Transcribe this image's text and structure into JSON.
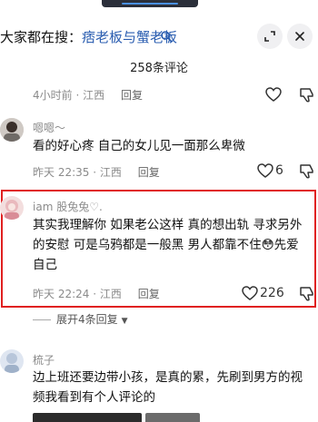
{
  "search": {
    "prefix": "大家都在搜：",
    "keyword": "痞老板与蟹老板",
    "icons": [
      "search-icon",
      "expand-icon",
      "close-icon"
    ]
  },
  "comments_header": {
    "count_label": "258条评论"
  },
  "comments": [
    {
      "time": "4小时前",
      "location": "江西",
      "reply_label": "回复"
    },
    {
      "username": "嗯嗯～",
      "text": "看的好心疼 自己的女儿见一面那么卑微",
      "time": "昨天 22:35",
      "location": "江西",
      "reply_label": "回复",
      "likes": "6"
    },
    {
      "username": "iam 股兔兔♡.",
      "text": "其实我理解你 如果老公这样 真的想出轨 寻求另外的安慰 可是乌鸦都是一般黑 男人都靠不住😳先爱自己",
      "time": "昨天 22:24",
      "location": "江西",
      "reply_label": "回复",
      "likes": "226",
      "highlighted": true
    },
    {
      "username": "梳子",
      "text": "边上班还要边带小孩，是真的累，先刷到男方的视频我看到有个人评论的"
    }
  ],
  "expand_replies": {
    "label": "展开4条回复"
  },
  "separator": " · ",
  "colors": {
    "highlight_border": "#e02020",
    "keyword": "#2a5db0",
    "meta": "#8b8b8b"
  }
}
